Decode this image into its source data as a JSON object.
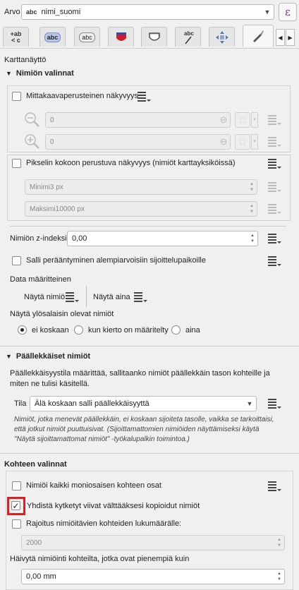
{
  "header": {
    "label": "Arvo",
    "field_type": "abc",
    "field_value": "nimi_suomi",
    "expression_symbol": "ε"
  },
  "tabs": [
    {
      "name": "text",
      "icon": "text-tab-icon"
    },
    {
      "name": "formatting",
      "icon": "formatting-tab-icon"
    },
    {
      "name": "buffer",
      "icon": "buffer-tab-icon"
    },
    {
      "name": "mask",
      "icon": "mask-tab-icon"
    },
    {
      "name": "background",
      "icon": "background-tab-icon"
    },
    {
      "name": "shadow",
      "icon": "shadow-tab-icon"
    },
    {
      "name": "callouts",
      "icon": "callouts-tab-icon"
    },
    {
      "name": "placement",
      "icon": "placement-tab-icon"
    },
    {
      "name": "rendering",
      "icon": "rendering-tab-icon",
      "active": true
    }
  ],
  "page_title": "Karttanäyttö",
  "label_options": {
    "title": "Nimiön valinnat",
    "scale_visibility_label": "Mittakaavaperusteinen näkyvyys",
    "min_scale_value": "0",
    "max_scale_value": "0",
    "pixel_size_label": "Pikselin kokoon perustuva näkyvyys (nimiöt karttayksiköissä)",
    "min_pixel": "Minimi3 px",
    "max_pixel": "Maksimi10000 px",
    "z_index_label": "Nimiön z-indeksi",
    "z_index_value": "0,00",
    "allow_degraded_label": "Salli perääntyminen alempiarvoisiin sijoittelupaikoille",
    "data_defined_label": "Data määritteinen",
    "show_label": "Näytä nimiö",
    "always_show": "Näytä aina",
    "upside_label": "Näytä ylösalaisin olevat nimiöt",
    "upside_options": [
      "ei koskaan",
      "kun kierto on määritelty",
      "aina"
    ],
    "upside_selected": 0
  },
  "overlapping": {
    "title": "Päällekkäiset nimiöt",
    "description": "Päällekkäisyystila määrittää, sallitaanko nimiöt päällekkäin tason kohteille ja miten ne tulisi käsitellä.",
    "mode_label": "Tila",
    "mode_value": "Älä koskaan salli päällekkäisyyttä",
    "note": "Nimiöt, jotka menevät päällekkäin, ei koskaan sijoiteta tasolle, vaikka se tarkoittaisi, että jotkut nimiöt puuttuisivat. (Sijoittamattomien nimiöiden näyttämiseksi käytä \"Näytä sijoittamattomat nimiöt\" -työkalupalkin toimintoa.)"
  },
  "feature_options": {
    "title": "Kohteen valinnat",
    "label_every_part": "Nimiöi kaikki moniosaisen kohteen osat",
    "merge_lines": "Yhdistä kytketyt viivat välttääksesi kopioidut nimiöt",
    "merge_checked": true,
    "limit_label": "Rajoitus nimiöitävien kohteiden lukumäärälle:",
    "limit_value": "2000",
    "suppress_label": "Häivytä nimiöinti kohteilta, jotka ovat pienempiä kuin",
    "suppress_value": "0,00 mm"
  },
  "colors": {
    "highlight": "#e02020",
    "expression": "#7b2b8f"
  }
}
